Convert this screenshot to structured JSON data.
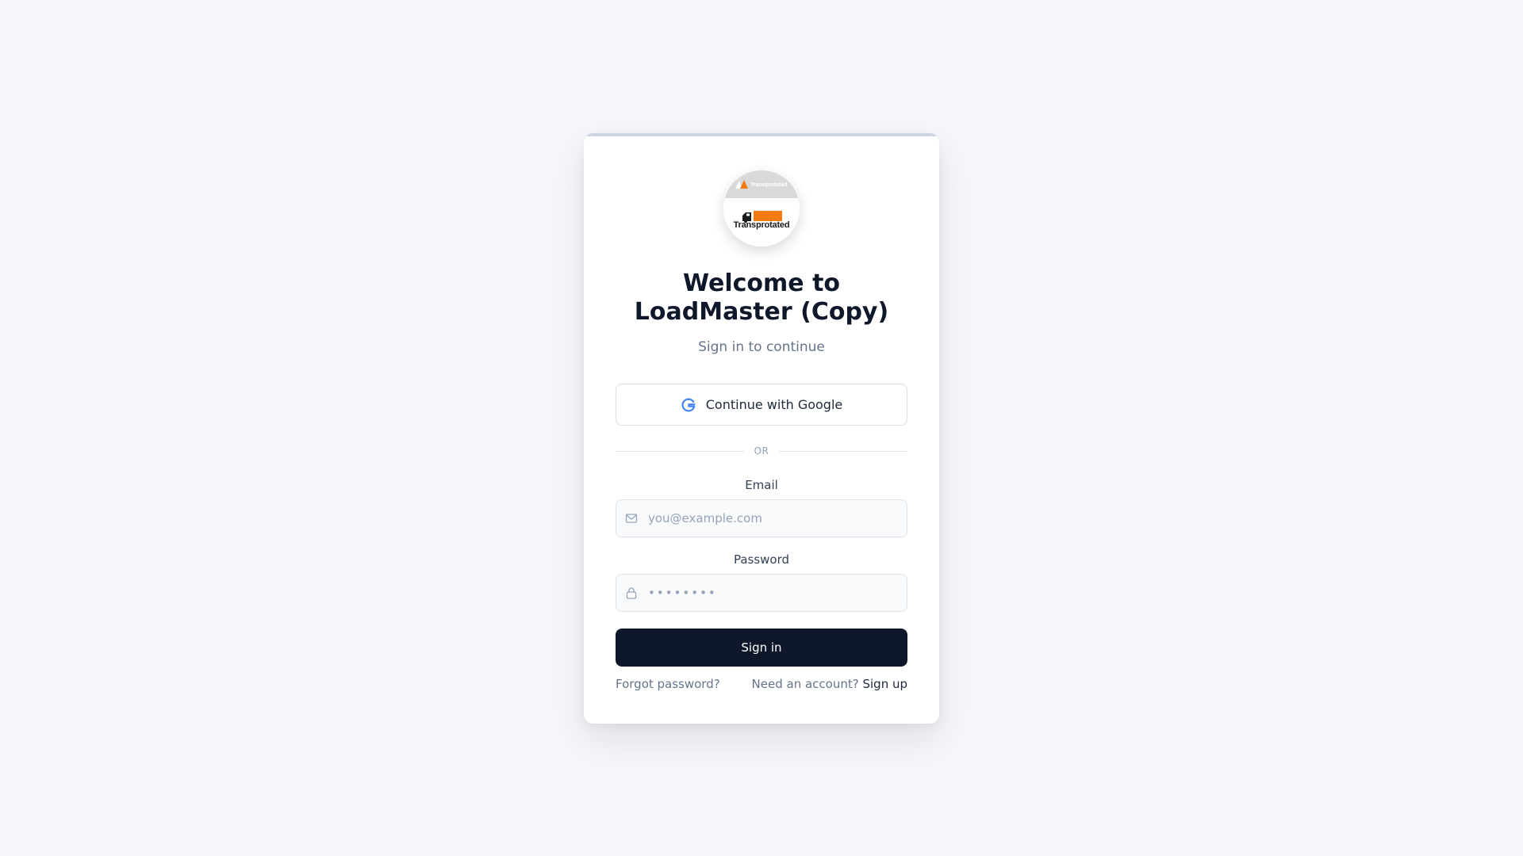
{
  "logo": {
    "top_text": "Transprotated",
    "bottom_text": "Transprotated",
    "colors": {
      "top_band": "#d9d9d9",
      "truck_orange": "#f47b12",
      "triangle_orange": "#f47b12"
    }
  },
  "header": {
    "title_line1": "Welcome to",
    "title_line2": "LoadMaster (Copy)",
    "subtitle": "Sign in to continue"
  },
  "google": {
    "label": "Continue with Google",
    "icon": "google-g-icon"
  },
  "divider": {
    "text": "OR"
  },
  "email": {
    "label": "Email",
    "placeholder": "you@example.com",
    "value": "",
    "icon": "mail-icon"
  },
  "password": {
    "label": "Password",
    "placeholder": "••••••••",
    "value": "",
    "icon": "lock-icon"
  },
  "signin": {
    "label": "Sign in"
  },
  "footer": {
    "forgot": "Forgot password?",
    "need_account": "Need an account?",
    "signup": "Sign up"
  },
  "colors": {
    "background": "#f5f7fa",
    "card": "#ffffff",
    "primary_button": "#0f172a",
    "google_blue": "#4285f4",
    "muted_text": "#64748b"
  }
}
